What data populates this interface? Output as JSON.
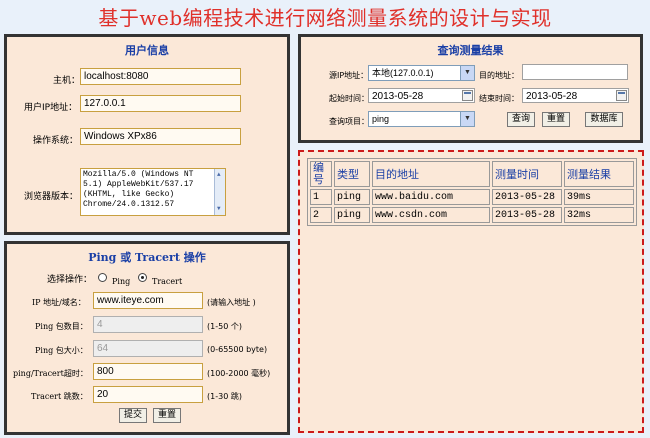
{
  "page_title": "基于web编程技术进行网络测量系统的设计与实现",
  "user_info": {
    "title": "用户信息",
    "host_label": "主机：",
    "host_value": "localhost:8080",
    "ip_label": "用户IP地址：",
    "ip_value": "127.0.0.1",
    "os_label": "操作系统：",
    "os_value": "Windows XPx86",
    "browser_label": "浏览器版本：",
    "browser_lines": [
      "Mozilla/5.0 (Windows NT",
      "5.1) AppleWebKit/537.17",
      "(KHTML, like Gecko)",
      "Chrome/24.0.1312.57"
    ]
  },
  "ping_panel": {
    "title": "Ping 或 Tracert 操作",
    "op_label": "选择操作：",
    "opt_ping": "Ping",
    "opt_tracert": "Tracert",
    "selected": "Tracert",
    "ip_label": "IP 地址/域名：",
    "ip_value": "www.iteye.com",
    "ip_hint": "(请输入地址 )",
    "count_label": "Ping 包数目：",
    "count_value": "4",
    "count_hint": "(1-50 个)",
    "size_label": "Ping 包大小：",
    "size_value": "64",
    "size_hint": "(0-65500 byte)",
    "timeout_label": "ping/Tracert超时：",
    "timeout_value": "800",
    "timeout_hint": "(100-2000 毫秒)",
    "hops_label": "Tracert 跳数：",
    "hops_value": "20",
    "hops_hint": "(1-30 跳)",
    "submit": "提交",
    "reset": "重置"
  },
  "query_panel": {
    "title": "查询测量结果",
    "src_label": "源IP地址：",
    "src_value": "本地(127.0.0.1)",
    "dst_label": "目的地址：",
    "dst_value": "",
    "start_label": "起始时间：",
    "start_value": "2013-05-28",
    "end_label": "结束时间：",
    "end_value": "2013-05-28",
    "item_label": "查询项目：",
    "item_value": "ping",
    "query_btn": "查询",
    "reset_btn": "重置",
    "db_btn": "数据库"
  },
  "results_table": {
    "headers": [
      "编号",
      "类型",
      "目的地址",
      "测量时间",
      "测量结果"
    ],
    "rows": [
      [
        "1",
        "ping",
        "www.baidu.com",
        "2013-05-28",
        "39ms"
      ],
      [
        "2",
        "ping",
        "www.csdn.com",
        "2013-05-28",
        "32ms"
      ]
    ]
  }
}
